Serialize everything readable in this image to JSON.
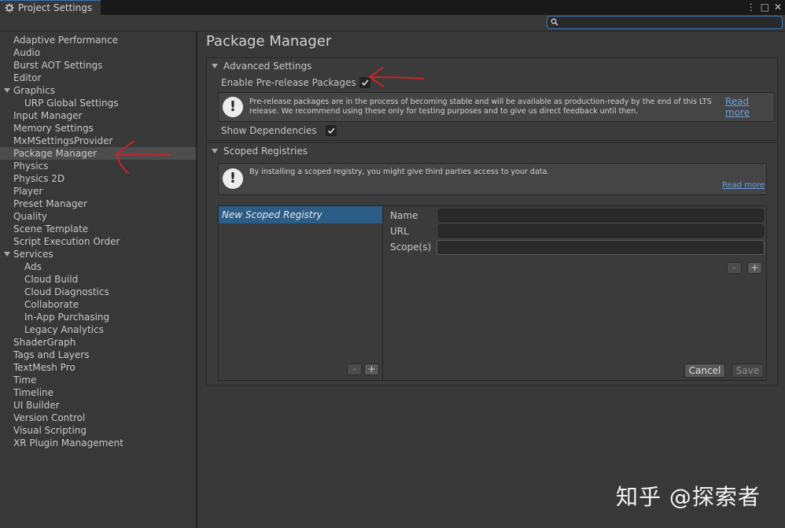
{
  "window": {
    "tab_title": "Project Settings",
    "controls": [
      "⋮",
      "□",
      "✕"
    ]
  },
  "search": {
    "placeholder": ""
  },
  "sidebar": {
    "items": [
      {
        "label": "Adaptive Performance",
        "level": 0
      },
      {
        "label": "Audio",
        "level": 0
      },
      {
        "label": "Burst AOT Settings",
        "level": 0
      },
      {
        "label": "Editor",
        "level": 0
      },
      {
        "label": "Graphics",
        "level": 0,
        "foldout": true
      },
      {
        "label": "URP Global Settings",
        "level": 1
      },
      {
        "label": "Input Manager",
        "level": 0
      },
      {
        "label": "Memory Settings",
        "level": 0
      },
      {
        "label": "MxMSettingsProvider",
        "level": 0
      },
      {
        "label": "Package Manager",
        "level": 0,
        "selected": true
      },
      {
        "label": "Physics",
        "level": 0
      },
      {
        "label": "Physics 2D",
        "level": 0
      },
      {
        "label": "Player",
        "level": 0
      },
      {
        "label": "Preset Manager",
        "level": 0
      },
      {
        "label": "Quality",
        "level": 0
      },
      {
        "label": "Scene Template",
        "level": 0
      },
      {
        "label": "Script Execution Order",
        "level": 0
      },
      {
        "label": "Services",
        "level": 0,
        "foldout": true
      },
      {
        "label": "Ads",
        "level": 1
      },
      {
        "label": "Cloud Build",
        "level": 1
      },
      {
        "label": "Cloud Diagnostics",
        "level": 1
      },
      {
        "label": "Collaborate",
        "level": 1
      },
      {
        "label": "In-App Purchasing",
        "level": 1
      },
      {
        "label": "Legacy Analytics",
        "level": 1
      },
      {
        "label": "ShaderGraph",
        "level": 0
      },
      {
        "label": "Tags and Layers",
        "level": 0
      },
      {
        "label": "TextMesh Pro",
        "level": 0
      },
      {
        "label": "Time",
        "level": 0
      },
      {
        "label": "Timeline",
        "level": 0
      },
      {
        "label": "UI Builder",
        "level": 0
      },
      {
        "label": "Version Control",
        "level": 0
      },
      {
        "label": "Visual Scripting",
        "level": 0
      },
      {
        "label": "XR Plugin Management",
        "level": 0
      }
    ]
  },
  "main": {
    "title": "Package Manager",
    "advanced": {
      "header": "Advanced Settings",
      "prerelease_label": "Enable Pre-release Packages",
      "prerelease_checked": true,
      "help_text_line1": "Pre-release packages are in the process of becoming stable and will be available as production-ready by the end of this LTS",
      "help_text_line2": "release. We recommend using these only for testing purposes and to give us direct feedback until then.",
      "read_more": "Read more",
      "show_deps_label": "Show Dependencies",
      "show_deps_checked": true
    },
    "scoped": {
      "header": "Scoped Registries",
      "help_text": "By installing a scoped registry, you might give third parties access to your data.",
      "read_more": "Read more",
      "registry_item": "New Scoped Registry",
      "name_label": "Name",
      "url_label": "URL",
      "scopes_label": "Scope(s)",
      "minus": "-",
      "plus": "+",
      "cancel": "Cancel",
      "save": "Save"
    }
  },
  "watermark": "知乎 @探索者",
  "colors": {
    "accent": "#3a79bb",
    "selection": "#2c5d87",
    "annotation": "#c8242a"
  }
}
